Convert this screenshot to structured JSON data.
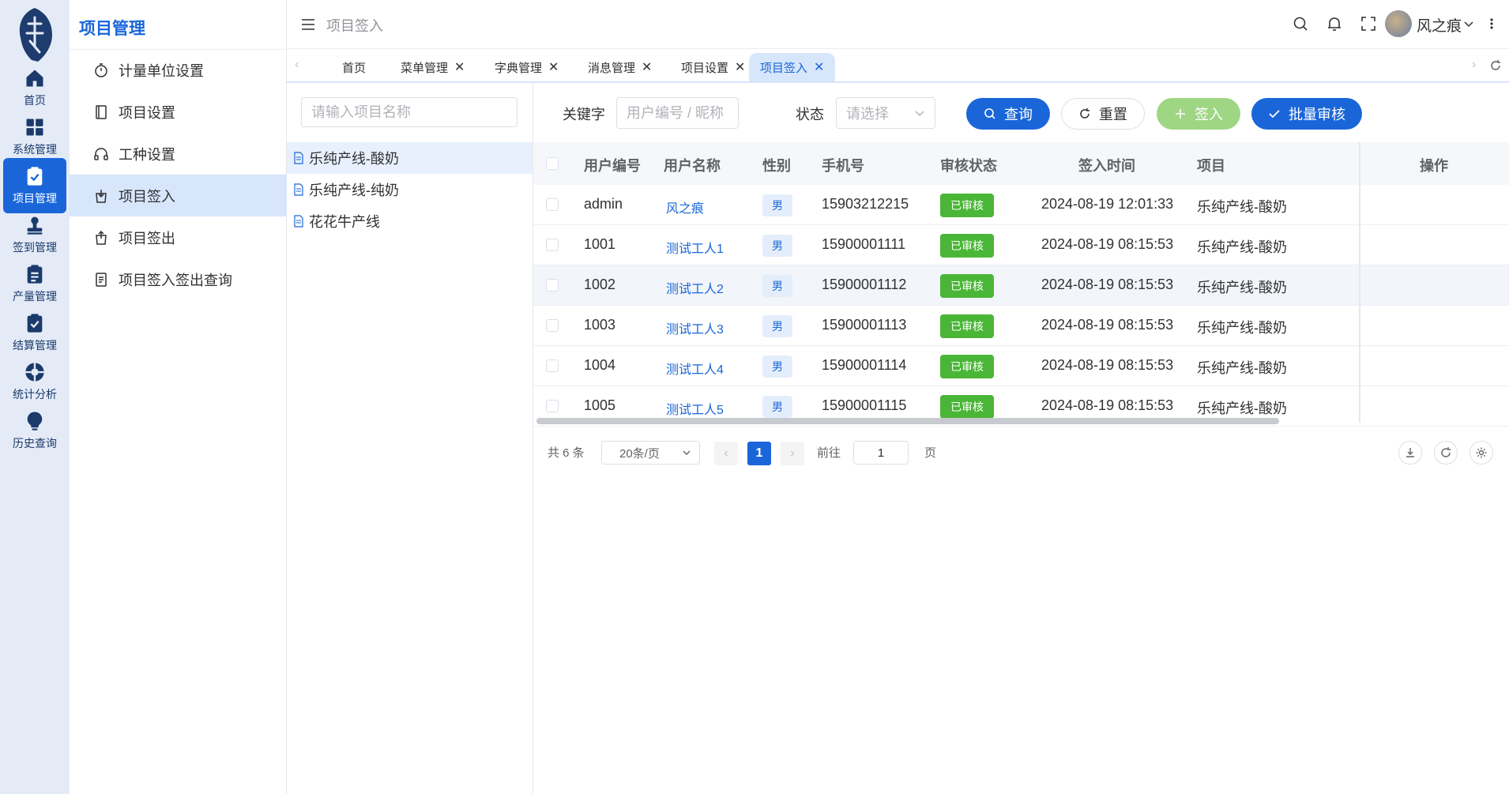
{
  "rail": {
    "items": [
      {
        "label": "首页",
        "icon": "home-icon"
      },
      {
        "label": "系统管理",
        "icon": "grid-icon"
      },
      {
        "label": "项目管理",
        "icon": "clipboard-check-icon"
      },
      {
        "label": "签到管理",
        "icon": "stamp-icon"
      },
      {
        "label": "产量管理",
        "icon": "clipboard-list-icon"
      },
      {
        "label": "结算管理",
        "icon": "clipboard-check-icon"
      },
      {
        "label": "统计分析",
        "icon": "lifebuoy-icon"
      },
      {
        "label": "历史查询",
        "icon": "lightbulb-icon"
      }
    ]
  },
  "submenu": {
    "title": "项目管理",
    "items": [
      {
        "label": "计量单位设置",
        "icon": "stopwatch-icon"
      },
      {
        "label": "项目设置",
        "icon": "book-icon"
      },
      {
        "label": "工种设置",
        "icon": "headset-icon"
      },
      {
        "label": "项目签入",
        "icon": "bag-in-icon"
      },
      {
        "label": "项目签出",
        "icon": "bag-out-icon"
      },
      {
        "label": "项目签入签出查询",
        "icon": "document-icon"
      }
    ]
  },
  "header": {
    "breadcrumb": "项目签入",
    "username": "风之痕"
  },
  "tabs": [
    {
      "label": "首页",
      "closable": false
    },
    {
      "label": "菜单管理",
      "closable": true
    },
    {
      "label": "字典管理",
      "closable": true
    },
    {
      "label": "消息管理",
      "closable": true
    },
    {
      "label": "项目设置",
      "closable": true
    },
    {
      "label": "项目签入",
      "closable": true
    }
  ],
  "project_panel": {
    "search_placeholder": "请输入项目名称",
    "projects": [
      "乐纯产线-酸奶",
      "乐纯产线-纯奶",
      "花花牛产线"
    ]
  },
  "filters": {
    "keyword_label": "关键字",
    "keyword_placeholder": "用户编号 / 昵称",
    "status_label": "状态",
    "status_placeholder": "请选择",
    "search_btn": "查询",
    "reset_btn": "重置",
    "checkin_btn": "签入",
    "batch_btn": "批量审核"
  },
  "table": {
    "columns": [
      "用户编号",
      "用户名称",
      "性别",
      "手机号",
      "审核状态",
      "签入时间",
      "项目",
      "操作"
    ],
    "rows": [
      {
        "id": "admin",
        "name": "风之痕",
        "gender": "男",
        "phone": "15903212215",
        "status": "已审核",
        "time": "2024-08-19 12:01:33",
        "project": "乐纯产线-酸奶"
      },
      {
        "id": "1001",
        "name": "测试工人1",
        "gender": "男",
        "phone": "15900001111",
        "status": "已审核",
        "time": "2024-08-19 08:15:53",
        "project": "乐纯产线-酸奶"
      },
      {
        "id": "1002",
        "name": "测试工人2",
        "gender": "男",
        "phone": "15900001112",
        "status": "已审核",
        "time": "2024-08-19 08:15:53",
        "project": "乐纯产线-酸奶"
      },
      {
        "id": "1003",
        "name": "测试工人3",
        "gender": "男",
        "phone": "15900001113",
        "status": "已审核",
        "time": "2024-08-19 08:15:53",
        "project": "乐纯产线-酸奶"
      },
      {
        "id": "1004",
        "name": "测试工人4",
        "gender": "男",
        "phone": "15900001114",
        "status": "已审核",
        "time": "2024-08-19 08:15:53",
        "project": "乐纯产线-酸奶"
      },
      {
        "id": "1005",
        "name": "测试工人5",
        "gender": "男",
        "phone": "15900001115",
        "status": "已审核",
        "time": "2024-08-19 08:15:53",
        "project": "乐纯产线-酸奶"
      }
    ]
  },
  "pagination": {
    "total": "共 6 条",
    "page_size": "20条/页",
    "current": "1",
    "goto_label": "前往",
    "goto_value": "1",
    "page_suffix": "页"
  },
  "colors": {
    "primary": "#1a66d9",
    "success": "#4ab637",
    "active_bg": "#d7e6fb",
    "rail_bg": "#e4ebf7"
  }
}
